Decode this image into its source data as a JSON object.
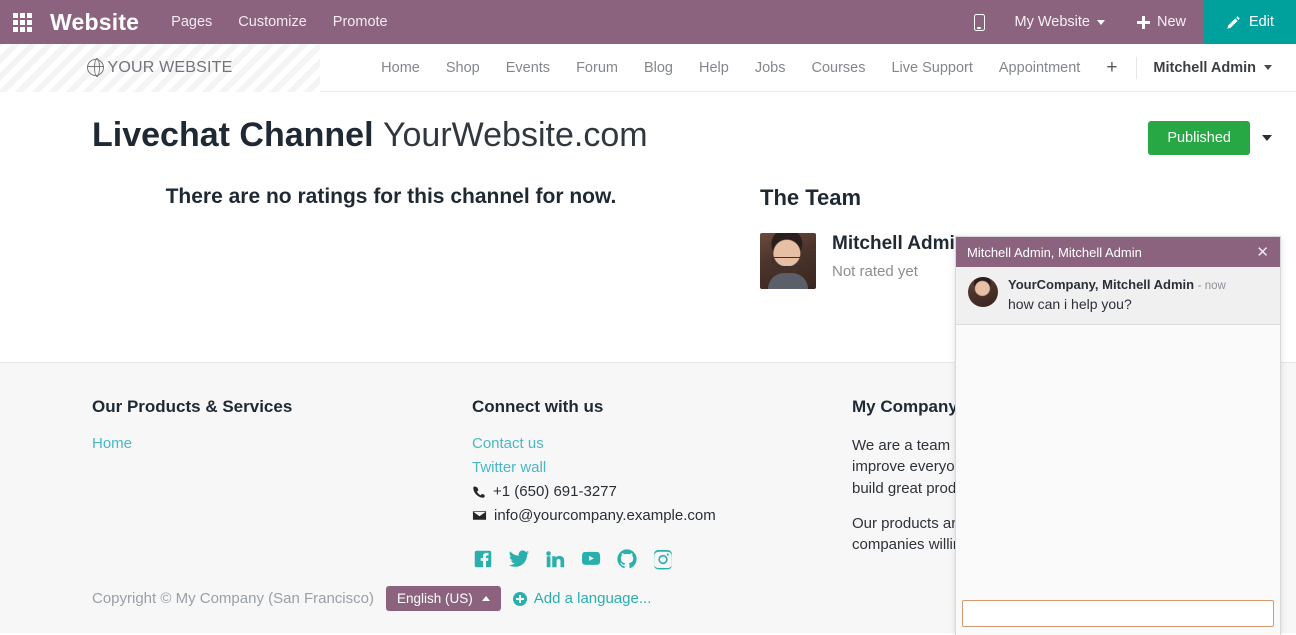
{
  "odoo_bar": {
    "apps_icon": "apps-grid-icon",
    "brand": "Website",
    "menu": [
      "Pages",
      "Customize",
      "Promote"
    ],
    "mobile_icon": "mobile-preview-icon",
    "website_selector": "My Website",
    "new_label": "New",
    "edit_label": "Edit",
    "bg_color": "#8b637f",
    "edit_color": "#00a09d"
  },
  "site_header": {
    "logo_icon": "globe-icon",
    "logo_text": "YOUR WEBSITE",
    "nav": [
      "Home",
      "Shop",
      "Events",
      "Forum",
      "Blog",
      "Help",
      "Jobs",
      "Courses",
      "Live Support",
      "Appointment"
    ],
    "nav_add": "+",
    "user": "Mitchell Admin"
  },
  "page": {
    "title": "Livechat Channel",
    "title_suffix": "YourWebsite.com",
    "publish_label": "Published",
    "publish_color": "#28a745",
    "no_ratings": "There are no ratings for this channel for now.",
    "team_title": "The Team",
    "team": [
      {
        "name": "Mitchell Admin",
        "status": "Not rated yet"
      }
    ]
  },
  "footer": {
    "col1": {
      "heading": "Our Products & Services",
      "links": [
        "Home"
      ]
    },
    "col2": {
      "heading": "Connect with us",
      "links": [
        "Contact us",
        "Twitter wall"
      ],
      "phone": "+1 (650) 691-3277",
      "email": "info@yourcompany.example.com",
      "social": [
        "facebook-icon",
        "twitter-icon",
        "linkedin-icon",
        "youtube-icon",
        "github-icon",
        "instagram-icon"
      ]
    },
    "col3": {
      "heading": "My Company",
      "paragraph1": "We are a team of passionate people whose goal is to improve everyone's life through disruptive products. We build great products to solve your business problems.",
      "paragraph2": "Our products are designed for small to medium size companies willing to optimize their performance."
    },
    "copyright": "Copyright © My Company (San Francisco)",
    "language": "English (US)",
    "add_language": "Add a language..."
  },
  "chat": {
    "header_title": "Mitchell Admin, Mitchell Admin",
    "close_icon": "close-icon",
    "message_author": "YourCompany, Mitchell Admin",
    "message_time": "- now",
    "message_text": "how can i help you?",
    "input_value": "",
    "input_placeholder": ""
  }
}
